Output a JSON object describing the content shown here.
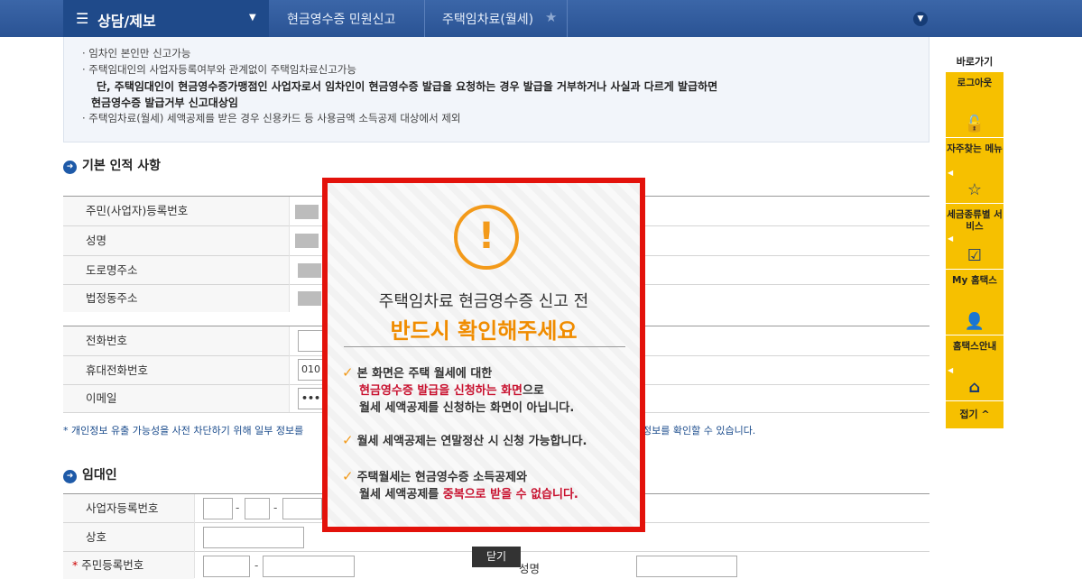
{
  "header": {
    "menu_label": "상담/제보",
    "crumb1": "현금영수증 민원신고",
    "crumb2": "주택임차료(월세)"
  },
  "notice": {
    "line1": "· 임차인 본인만 신고가능",
    "line2": "· 주택임대인의 사업자등록여부와 관계없이 주택임차료신고가능",
    "line3": "단, 주택임대인이 현금영수증가맹점인 사업자로서 임차인이 현금영수증 발급을 요청하는 경우 발급을 거부하거나 사실과 다르게 발급하면",
    "line4": "현금영수증 발급거부 신고대상임",
    "line5": "· 주택임차료(월세) 세액공제를 받은 경우 신용카드 등 사용금액 소득공제 대상에서 제외"
  },
  "basic": {
    "title": "기본 인적 사항",
    "rows": [
      "주민(사업자)등록번호",
      "성명",
      "도로명주소",
      "법정동주소"
    ],
    "phone_label": "전화번호",
    "mobile_label": "휴대전화번호",
    "mobile_value": "010",
    "email_label": "이메일",
    "email_value": "•••",
    "privacy_note": "* 개인정보 유출 가능성을 사전 차단하기 위해 일부 정보를",
    "privacy_note2": "정보를 확인할 수 있습니다."
  },
  "landlord": {
    "title": "임대인",
    "bizno_label": "사업자등록번호",
    "name_label": "상호",
    "rrn_label": "주민등록번호",
    "rrn_req": "*",
    "person_label": "성명"
  },
  "quick": {
    "head": "바로가기",
    "items": [
      "로그아웃",
      "자주찾는 메뉴",
      "세금종류별 서비스",
      "My 홈택스",
      "홈택스안내"
    ],
    "close": "접기"
  },
  "popup": {
    "title1": "주택임차료 현금영수증 신고 전",
    "title2": "반드시 확인해주세요",
    "b1_l1": "본 화면은 주택 월세에 대한",
    "b1_red": "현금영수증 발급을 신청하는 화면",
    "b1_tail": "으로",
    "b1_l3": "월세 세액공제를 신청하는 화면이 아닙니다.",
    "b2": "월세 세액공제는 연말정산 시 신청 가능합니다.",
    "b3_l1": "주택월세는 현금영수증 소득공제와",
    "b3_pre": "월세 세액공제를 ",
    "b3_red": "중복으로 받을 수 없습니다.",
    "close_label": "닫기"
  }
}
